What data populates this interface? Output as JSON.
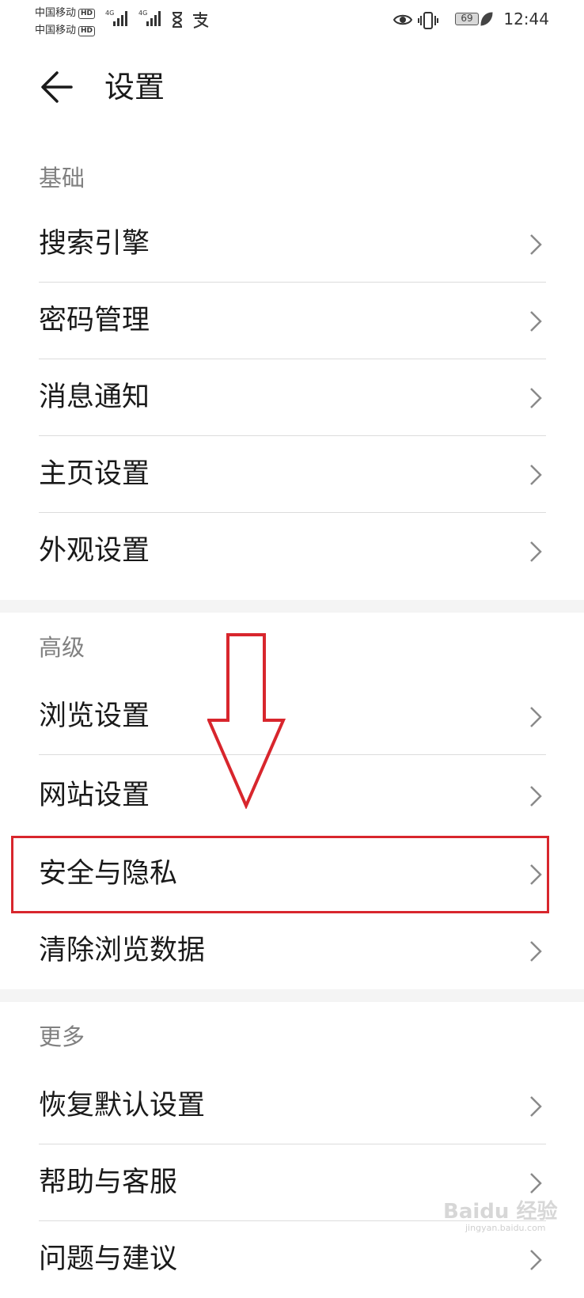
{
  "status_bar": {
    "carrier_1": "中国移动",
    "carrier_2": "中国移动",
    "hd": "HD",
    "signal_1_label": "4G",
    "signal_2_label": "4G",
    "battery": "69",
    "time": "12:44",
    "icons": [
      "hourglass-icon",
      "alipay-icon",
      "eye-icon",
      "vibrate-icon",
      "battery-icon",
      "leaf-icon"
    ]
  },
  "header": {
    "title": "设置",
    "back_icon": "back-arrow-icon"
  },
  "sections": [
    {
      "label": "基础",
      "items": [
        "搜索引擎",
        "密码管理",
        "消息通知",
        "主页设置",
        "外观设置"
      ]
    },
    {
      "label": "高级",
      "items": [
        "浏览设置",
        "网站设置",
        "安全与隐私",
        "清除浏览数据"
      ]
    },
    {
      "label": "更多",
      "items": [
        "恢复默认设置",
        "帮助与客服",
        "问题与建议"
      ]
    }
  ],
  "annotation": {
    "highlight_item": "安全与隐私",
    "color": "#d8262d"
  },
  "watermark": {
    "brand": "Baidu 经验",
    "url": "jingyan.baidu.com"
  }
}
